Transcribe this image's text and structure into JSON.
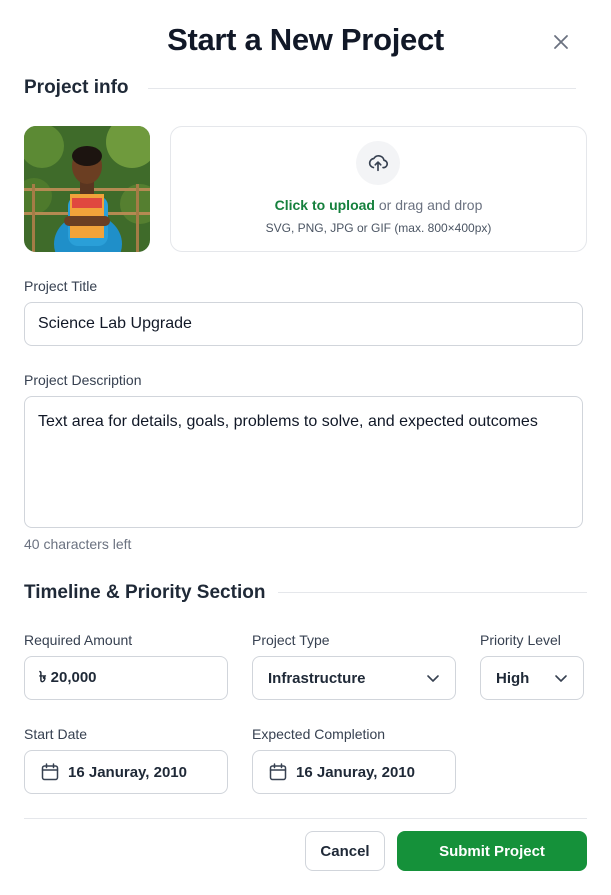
{
  "dialog": {
    "title": "Start a New Project",
    "close_icon": "x-icon"
  },
  "project_info": {
    "heading": "Project info",
    "upload": {
      "icon": "upload-cloud-icon",
      "link_text": "Click to upload",
      "rest_text": " or drag and drop",
      "hint": "SVG, PNG, JPG or GIF (max. 800×400px)"
    }
  },
  "project_title": {
    "label": "Project Title",
    "value": "Science Lab Upgrade"
  },
  "project_description": {
    "label": "Project Description",
    "value": "Text area for details, goals, problems to solve, and expected outcomes",
    "char_hint": "40 characters left"
  },
  "timeline": {
    "heading": "Timeline & Priority Section",
    "required_amount": {
      "label": "Required Amount",
      "value": "৳ 20,000"
    },
    "project_type": {
      "label": "Project Type",
      "value": "Infrastructure"
    },
    "priority_level": {
      "label": "Priority Level",
      "value": "High"
    },
    "start_date": {
      "label": "Start Date",
      "value": "16 Januray, 2010"
    },
    "expected_completion": {
      "label": "Expected Completion",
      "value": "16 Januray, 2010"
    }
  },
  "actions": {
    "cancel": "Cancel",
    "submit": "Submit Project"
  },
  "colors": {
    "accent": "#15913a",
    "link": "#15803d",
    "border": "#d1d5db"
  }
}
